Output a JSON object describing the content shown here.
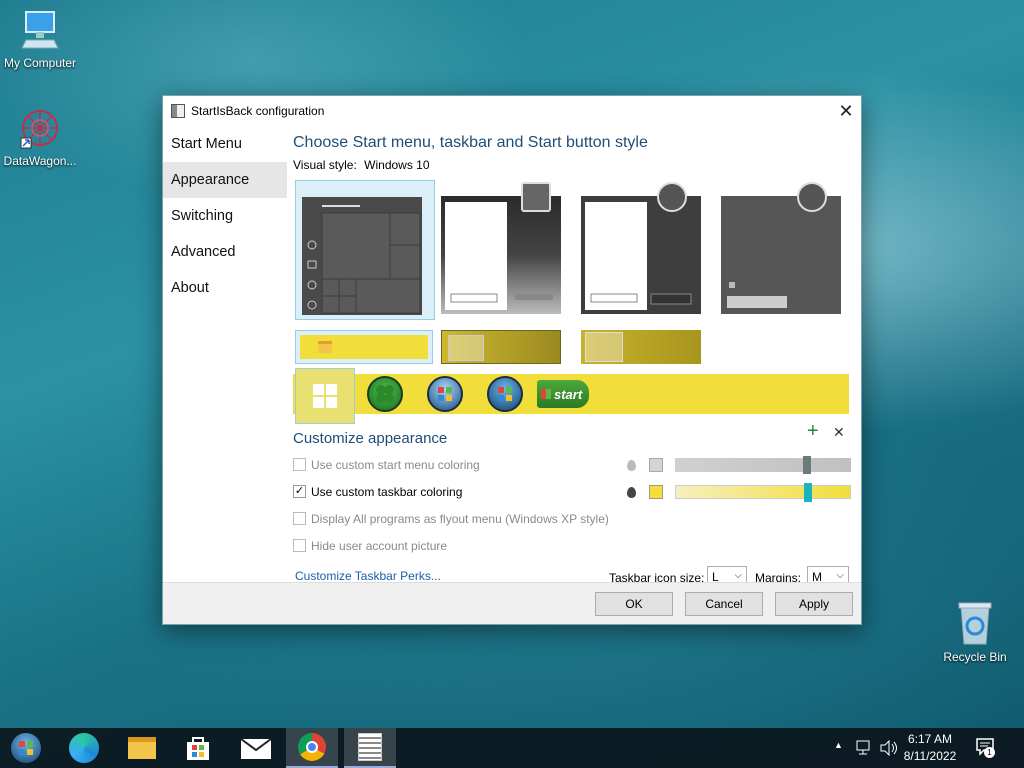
{
  "desktop": {
    "icons": [
      {
        "label": "My Computer"
      },
      {
        "label": "DataWagon..."
      },
      {
        "label": "Recycle Bin"
      }
    ]
  },
  "window": {
    "title": "StartIsBack configuration",
    "close_glyph": "✕"
  },
  "sidebar": {
    "items": [
      {
        "label": "Start Menu"
      },
      {
        "label": "Appearance"
      },
      {
        "label": "Switching"
      },
      {
        "label": "Advanced"
      },
      {
        "label": "About"
      }
    ],
    "selected": "Appearance"
  },
  "main": {
    "heading": "Choose Start menu, taskbar and Start button style",
    "visual_style_label": "Visual style:",
    "visual_style_value": "Windows 10",
    "customize_heading": "Customize appearance",
    "add_glyph": "+",
    "remove_glyph": "✕",
    "options": [
      {
        "label": "Use custom start menu coloring",
        "checked": false,
        "enabled": true
      },
      {
        "label": "Use custom taskbar coloring",
        "checked": true,
        "enabled": true
      },
      {
        "label": "Display All programs as flyout menu (Windows XP style)",
        "checked": false,
        "enabled": false
      },
      {
        "label": "Hide user account picture",
        "checked": false,
        "enabled": false
      }
    ],
    "check_glyph": "✓",
    "perks_link": "Customize Taskbar Perks...",
    "icon_size_label": "Taskbar icon size:",
    "icon_size_value": "L",
    "margins_label": "Margins:",
    "margins_value": "M",
    "start_button_text": "start",
    "startmenu_color": "#d4d4d4",
    "taskbar_color": "#f2de3a"
  },
  "footer": {
    "ok": "OK",
    "cancel": "Cancel",
    "apply": "Apply"
  },
  "taskbar": {
    "time": "6:17 AM",
    "date": "8/11/2022",
    "tray_chevron": "▲",
    "notification_count": "1"
  }
}
